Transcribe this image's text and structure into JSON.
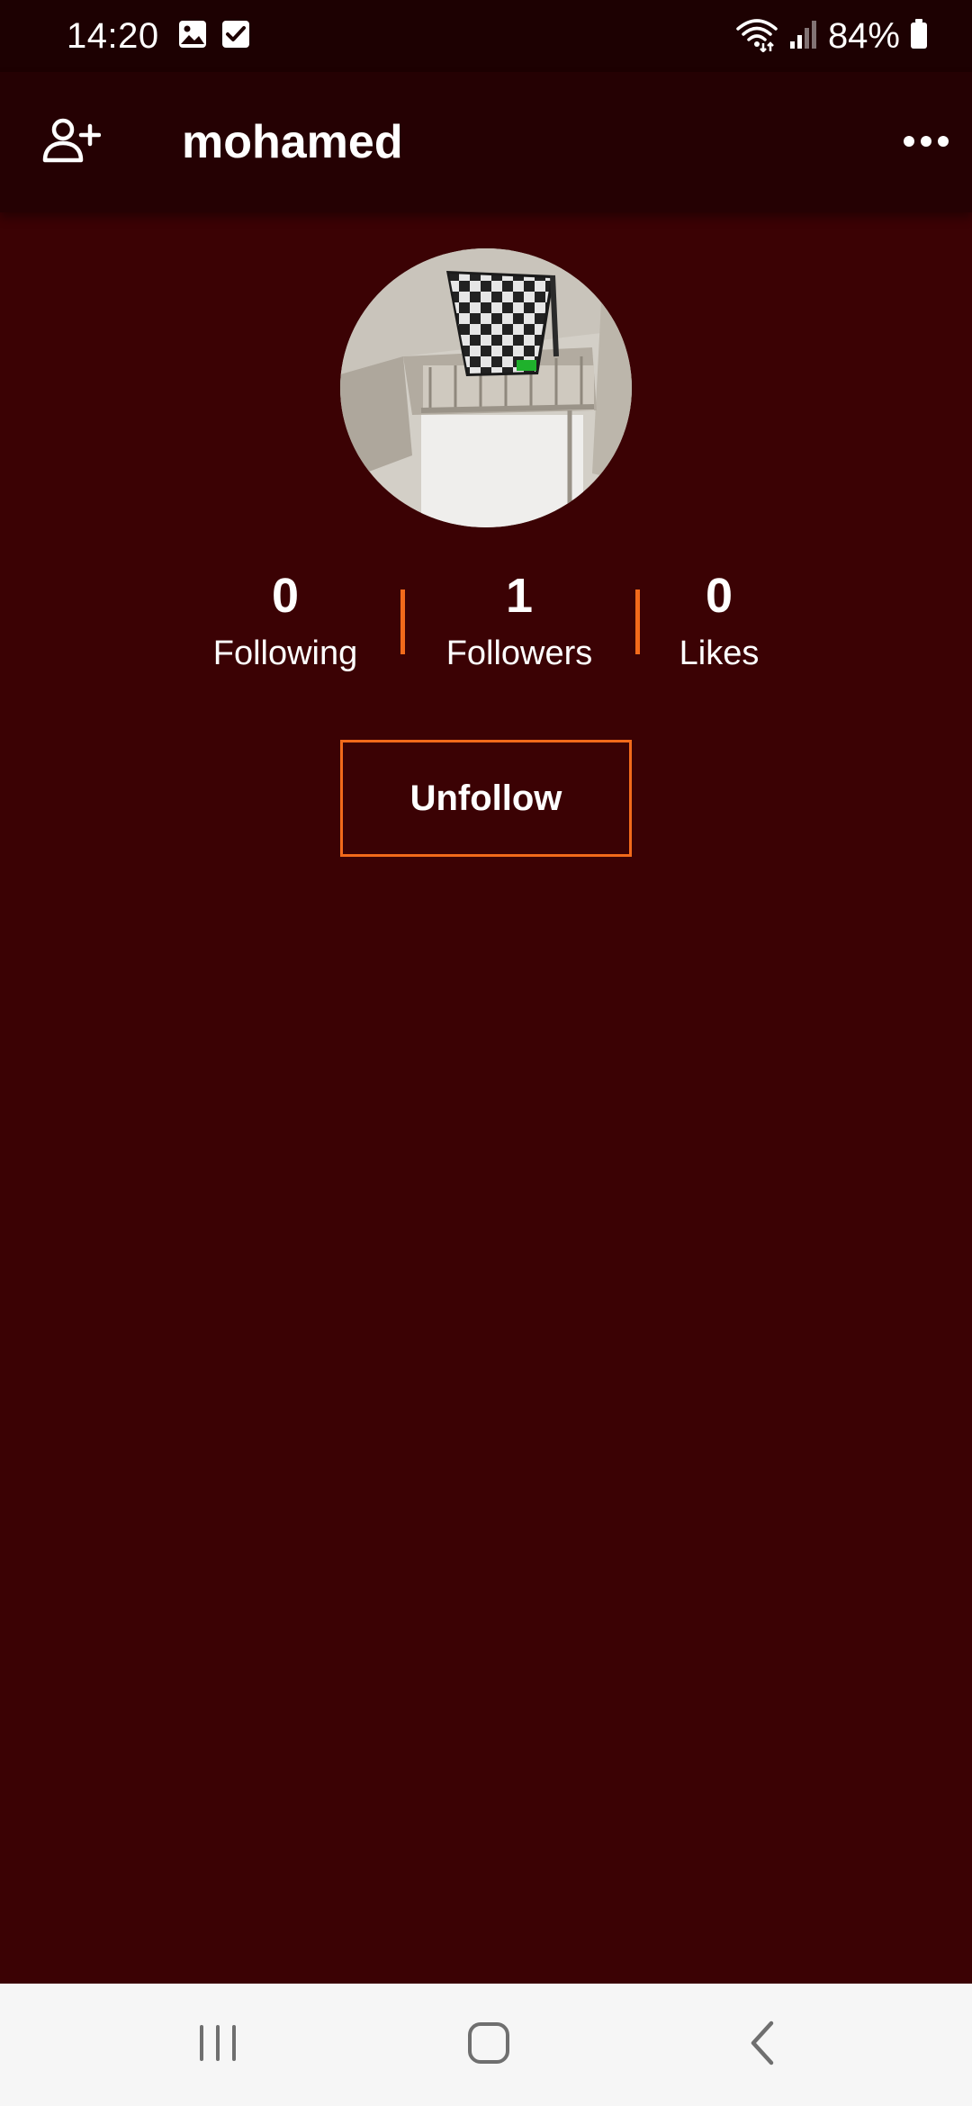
{
  "status_bar": {
    "time": "14:20",
    "battery": "84%",
    "icons": [
      "gallery-icon",
      "checkbox-icon",
      "wifi-icon",
      "signal-icon",
      "battery-icon"
    ]
  },
  "header": {
    "title": "mohamed",
    "left_icon": "add-user-icon",
    "right_icon": "more-icon"
  },
  "profile": {
    "stats": [
      {
        "value": "0",
        "label": "Following"
      },
      {
        "value": "1",
        "label": "Followers"
      },
      {
        "value": "0",
        "label": "Likes"
      }
    ],
    "action_label": "Unfollow"
  },
  "navigation": {
    "icons": [
      "recent-apps-icon",
      "home-icon",
      "back-icon"
    ]
  },
  "colors": {
    "background": "#3b0204",
    "app_bar": "#250103",
    "accent": "#f26a1b",
    "nav_bar": "#f6f6f6"
  }
}
